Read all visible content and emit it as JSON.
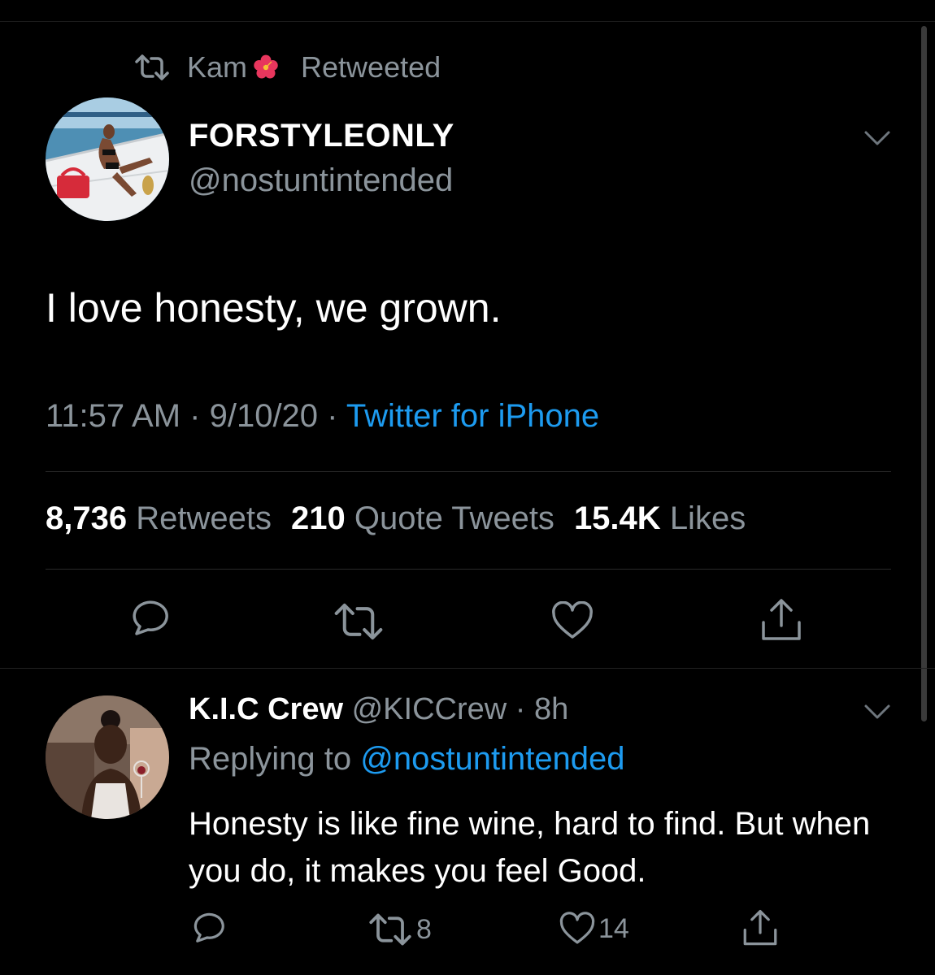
{
  "retweet_bar": {
    "user": "Kam",
    "emoji_icon": "hibiscus-icon",
    "label": "Retweeted"
  },
  "tweet": {
    "display_name": "FORSTYLEONLY",
    "handle": "@nostuntintended",
    "text": "I love honesty, we grown.",
    "time": "11:57 AM",
    "date": "9/10/20",
    "separator": " · ",
    "source": "Twitter for iPhone"
  },
  "stats": {
    "retweets_count": "8,736",
    "retweets_label": "Retweets",
    "quotes_count": "210",
    "quotes_label": "Quote Tweets",
    "likes_count": "15.4K",
    "likes_label": "Likes"
  },
  "actions": [
    "reply-icon",
    "retweet-icon",
    "like-icon",
    "share-icon"
  ],
  "reply": {
    "display_name": "K.I.C Crew",
    "handle": "@KICCrew",
    "separator": " · ",
    "age": "8h",
    "replying_label": "Replying to",
    "replying_to": "@nostuntintended",
    "text": "Honesty is like fine wine, hard to find. But when you do, it makes you feel Good.",
    "retweet_count": "8",
    "like_count": "14"
  },
  "colors": {
    "background": "#000000",
    "muted": "#8b949b",
    "link": "#1d9bf0",
    "text": "#ffffff"
  }
}
